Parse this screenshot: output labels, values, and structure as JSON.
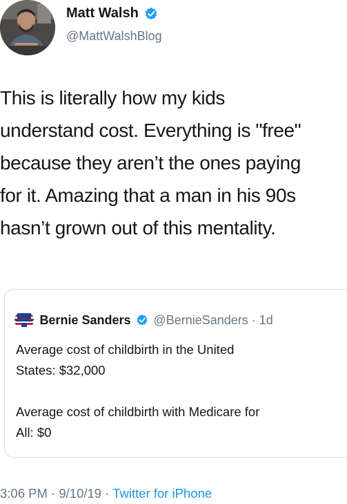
{
  "author": {
    "name": "Matt Walsh",
    "handle": "@MattWalshBlog",
    "verified_color": "#1da1f2"
  },
  "tweet": {
    "text_lines": [
      "This is literally how my kids",
      "understand cost. Everything is \"free\"",
      "because they aren’t the ones paying",
      "for it. Amazing that a man in his 90s",
      "hasn’t grown out of this mentality."
    ]
  },
  "quoted_tweet": {
    "name": "Bernie Sanders",
    "handle_time": "@BernieSanders · 1d",
    "paragraphs": [
      [
        "Average cost of childbirth in the United",
        "States: $32,000"
      ],
      [
        "Average cost of childbirth with Medicare for",
        "All: $0"
      ]
    ]
  },
  "meta": {
    "time": "3:06 PM",
    "sep1": " · ",
    "date": "9/10/19",
    "sep2": " · ",
    "source": "Twitter for iPhone"
  },
  "colors": {
    "text": "#14171a",
    "secondary": "#657786",
    "link": "#1b95e0",
    "border": "#d6dde3"
  }
}
